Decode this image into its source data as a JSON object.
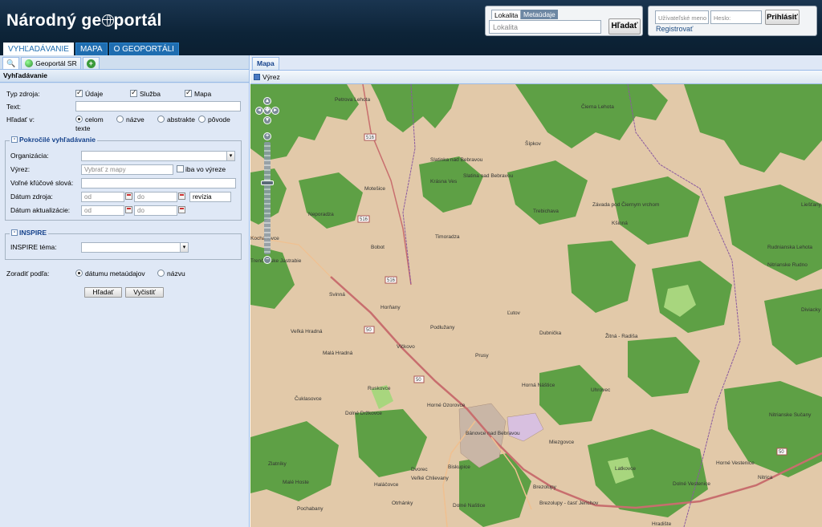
{
  "header": {
    "logo_part1": "Národný ge",
    "logo_part2": "portál",
    "nav_tabs": [
      "VYHĽADÁVANIE",
      "MAPA",
      "O GEOPORTÁLI"
    ],
    "location": {
      "tab_a": "Lokalita",
      "tab_b": "Metaúdaje",
      "placeholder": "Lokalita",
      "button": "Hľadať"
    },
    "login": {
      "user_placeholder": "Užívateľské meno",
      "pass_placeholder": "Heslo:",
      "button": "Prihlásiť",
      "register": "Registrovať"
    }
  },
  "left": {
    "tabs": [
      "",
      "Geoportál SR",
      ""
    ],
    "panel_title": "Vyhľadávanie",
    "typ_zdroja": "Typ zdroja:",
    "opt_udaje": "Údaje",
    "opt_sluzba": "Služba",
    "opt_mapa": "Mapa",
    "text_label": "Text:",
    "hladat_v": "Hľadať v:",
    "hv_celom": "celom",
    "hv_texte": "texte",
    "hv_nazve": "názve",
    "hv_abstrakte": "abstrakte",
    "hv_povode": "pôvode",
    "advanced": {
      "legend": "Pokročilé vyhľadávanie",
      "organizacia": "Organizácia:",
      "vyrez": "Výrez:",
      "vyrez_placeholder": "Vybrať z mapy",
      "iba_vo_vyreze": "iba vo výreze",
      "klucove": "Voľné kľúčové slová:",
      "datum_zdroja": "Dátum zdroja:",
      "datum_aktualizacie": "Dátum aktualizácie:",
      "od": "od",
      "do": "do",
      "revizia": "revízia"
    },
    "inspire": {
      "legend": "INSPIRE",
      "tema": "INSPIRE téma:"
    },
    "zoradit": "Zoradiť podľa:",
    "sort_datum": "dátumu metaúdajov",
    "sort_nazov": "názvu",
    "btn_hladat": "Hľadať",
    "btn_vycistit": "Vyčistiť"
  },
  "map": {
    "tab": "Mapa",
    "tool_vyrez": "Výrez",
    "towns": [
      "Petrova Lehota",
      "Čierna Lehota",
      "Šípkov",
      "Slatinka nad Bebravou",
      "Slatina nad Bebravou",
      "Krásna Ves",
      "Motešice",
      "Neporadza",
      "Trebichava",
      "Závada pod Čiernym vrchom",
      "Kšinná",
      "Timoradza",
      "Bobot",
      "Liešťany",
      "Rudnianska Lehota",
      "Nitrianske Rudno",
      "Svinná",
      "Horňany",
      "Podlužany",
      "Veľká Hradná",
      "Malá Hradná",
      "Ľutov",
      "Dubnička",
      "Žitná - Radiša",
      "Vlčkovo",
      "Prusy",
      "Diviacky",
      "Ruskovce",
      "Horné Ozorovce",
      "Horná Náštice",
      "Uhrovec",
      "Čuklasovce",
      "Dolné Držkovce",
      "Bánovce nad Bebravou",
      "Miezgovce",
      "Nitrianske Sučany",
      "Zlatníky",
      "Biskupice",
      "Dvorec",
      "Veľké Chlievany",
      "Latkovce",
      "Horné Vestenice",
      "Malé Hoste",
      "Haláčovce",
      "Brezolupy",
      "Dolné Vestenice",
      "Nitrica",
      "Pochabany",
      "Otrhánky",
      "Dolné Naštice",
      "Brezolupy - časť Jerichov",
      "Hradište",
      "Kochanovce",
      "Trenčianske Jastrabie"
    ],
    "roads": [
      "516",
      "516",
      "516",
      "50",
      "50",
      "50"
    ]
  }
}
